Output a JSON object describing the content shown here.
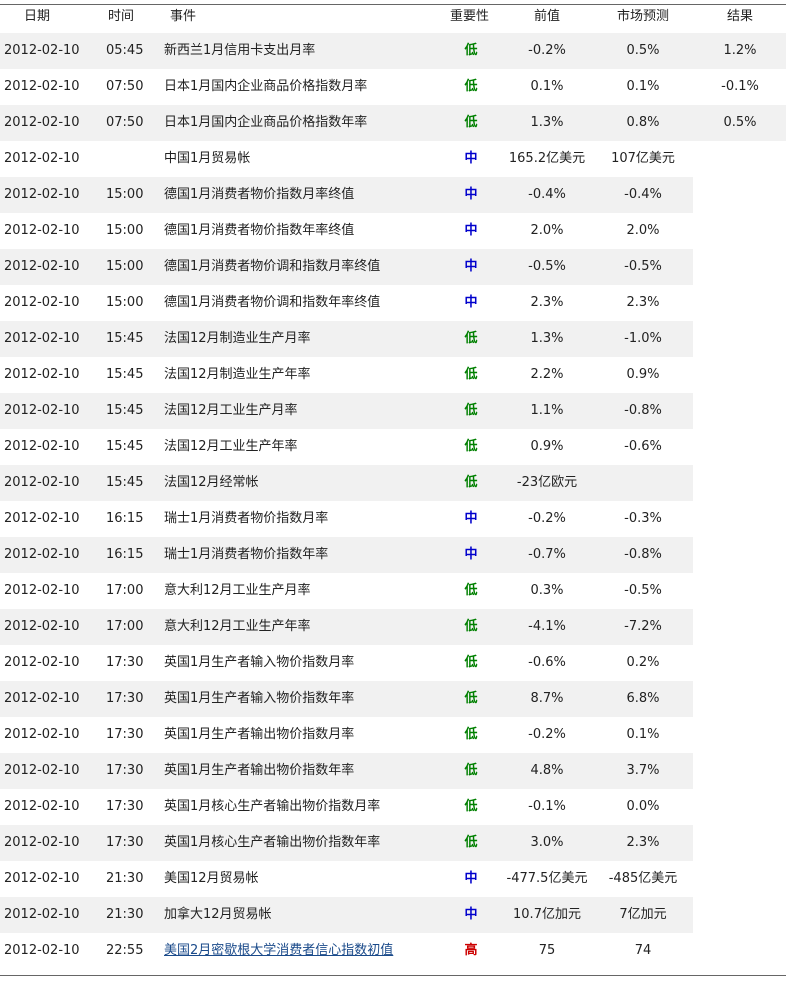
{
  "table": {
    "headers": {
      "date": "日期",
      "time": "时间",
      "event": "事件",
      "importance": "重要性",
      "previous": "前值",
      "forecast": "市场预测",
      "result": "结果"
    },
    "importance_colors": {
      "低": "#008000",
      "中": "#0000cc",
      "高": "#cc0000"
    },
    "rows": [
      {
        "date": "2012-02-10",
        "time": "05:45",
        "event": "新西兰1月信用卡支出月率",
        "importance": "低",
        "previous": "-0.2%",
        "forecast": "0.5%",
        "result": "1.2%"
      },
      {
        "date": "2012-02-10",
        "time": "07:50",
        "event": "日本1月国内企业商品价格指数月率",
        "importance": "低",
        "previous": "0.1%",
        "forecast": "0.1%",
        "result": "-0.1%"
      },
      {
        "date": "2012-02-10",
        "time": "07:50",
        "event": "日本1月国内企业商品价格指数年率",
        "importance": "低",
        "previous": "1.3%",
        "forecast": "0.8%",
        "result": "0.5%"
      },
      {
        "date": "2012-02-10",
        "time": "",
        "event": "中国1月贸易帐",
        "importance": "中",
        "previous": "165.2亿美元",
        "forecast": "107亿美元",
        "result": ""
      },
      {
        "date": "2012-02-10",
        "time": "15:00",
        "event": "德国1月消费者物价指数月率终值",
        "importance": "中",
        "previous": "-0.4%",
        "forecast": "-0.4%",
        "result": ""
      },
      {
        "date": "2012-02-10",
        "time": "15:00",
        "event": "德国1月消费者物价指数年率终值",
        "importance": "中",
        "previous": "2.0%",
        "forecast": "2.0%",
        "result": ""
      },
      {
        "date": "2012-02-10",
        "time": "15:00",
        "event": "德国1月消费者物价调和指数月率终值",
        "importance": "中",
        "previous": "-0.5%",
        "forecast": "-0.5%",
        "result": ""
      },
      {
        "date": "2012-02-10",
        "time": "15:00",
        "event": "德国1月消费者物价调和指数年率终值",
        "importance": "中",
        "previous": "2.3%",
        "forecast": "2.3%",
        "result": ""
      },
      {
        "date": "2012-02-10",
        "time": "15:45",
        "event": "法国12月制造业生产月率",
        "importance": "低",
        "previous": "1.3%",
        "forecast": "-1.0%",
        "result": ""
      },
      {
        "date": "2012-02-10",
        "time": "15:45",
        "event": "法国12月制造业生产年率",
        "importance": "低",
        "previous": "2.2%",
        "forecast": "0.9%",
        "result": ""
      },
      {
        "date": "2012-02-10",
        "time": "15:45",
        "event": "法国12月工业生产月率",
        "importance": "低",
        "previous": "1.1%",
        "forecast": "-0.8%",
        "result": ""
      },
      {
        "date": "2012-02-10",
        "time": "15:45",
        "event": "法国12月工业生产年率",
        "importance": "低",
        "previous": "0.9%",
        "forecast": "-0.6%",
        "result": ""
      },
      {
        "date": "2012-02-10",
        "time": "15:45",
        "event": "法国12月经常帐",
        "importance": "低",
        "previous": "-23亿欧元",
        "forecast": "",
        "result": ""
      },
      {
        "date": "2012-02-10",
        "time": "16:15",
        "event": "瑞士1月消费者物价指数月率",
        "importance": "中",
        "previous": "-0.2%",
        "forecast": "-0.3%",
        "result": ""
      },
      {
        "date": "2012-02-10",
        "time": "16:15",
        "event": "瑞士1月消费者物价指数年率",
        "importance": "中",
        "previous": "-0.7%",
        "forecast": "-0.8%",
        "result": ""
      },
      {
        "date": "2012-02-10",
        "time": "17:00",
        "event": "意大利12月工业生产月率",
        "importance": "低",
        "previous": "0.3%",
        "forecast": "-0.5%",
        "result": ""
      },
      {
        "date": "2012-02-10",
        "time": "17:00",
        "event": "意大利12月工业生产年率",
        "importance": "低",
        "previous": "-4.1%",
        "forecast": "-7.2%",
        "result": ""
      },
      {
        "date": "2012-02-10",
        "time": "17:30",
        "event": "英国1月生产者输入物价指数月率",
        "importance": "低",
        "previous": "-0.6%",
        "forecast": "0.2%",
        "result": ""
      },
      {
        "date": "2012-02-10",
        "time": "17:30",
        "event": "英国1月生产者输入物价指数年率",
        "importance": "低",
        "previous": "8.7%",
        "forecast": "6.8%",
        "result": ""
      },
      {
        "date": "2012-02-10",
        "time": "17:30",
        "event": "英国1月生产者输出物价指数月率",
        "importance": "低",
        "previous": "-0.2%",
        "forecast": "0.1%",
        "result": ""
      },
      {
        "date": "2012-02-10",
        "time": "17:30",
        "event": "英国1月生产者输出物价指数年率",
        "importance": "低",
        "previous": "4.8%",
        "forecast": "3.7%",
        "result": ""
      },
      {
        "date": "2012-02-10",
        "time": "17:30",
        "event": "英国1月核心生产者输出物价指数月率",
        "importance": "低",
        "previous": "-0.1%",
        "forecast": "0.0%",
        "result": ""
      },
      {
        "date": "2012-02-10",
        "time": "17:30",
        "event": "英国1月核心生产者输出物价指数年率",
        "importance": "低",
        "previous": "3.0%",
        "forecast": "2.3%",
        "result": ""
      },
      {
        "date": "2012-02-10",
        "time": "21:30",
        "event": "美国12月贸易帐",
        "importance": "中",
        "previous": "-477.5亿美元",
        "forecast": "-485亿美元",
        "result": ""
      },
      {
        "date": "2012-02-10",
        "time": "21:30",
        "event": "加拿大12月贸易帐",
        "importance": "中",
        "previous": "10.7亿加元",
        "forecast": "7亿加元",
        "result": ""
      },
      {
        "date": "2012-02-10",
        "time": "22:55",
        "event": "美国2月密歇根大学消费者信心指数初值",
        "importance": "高",
        "previous": "75",
        "forecast": "74",
        "result": "",
        "link": true
      }
    ]
  }
}
